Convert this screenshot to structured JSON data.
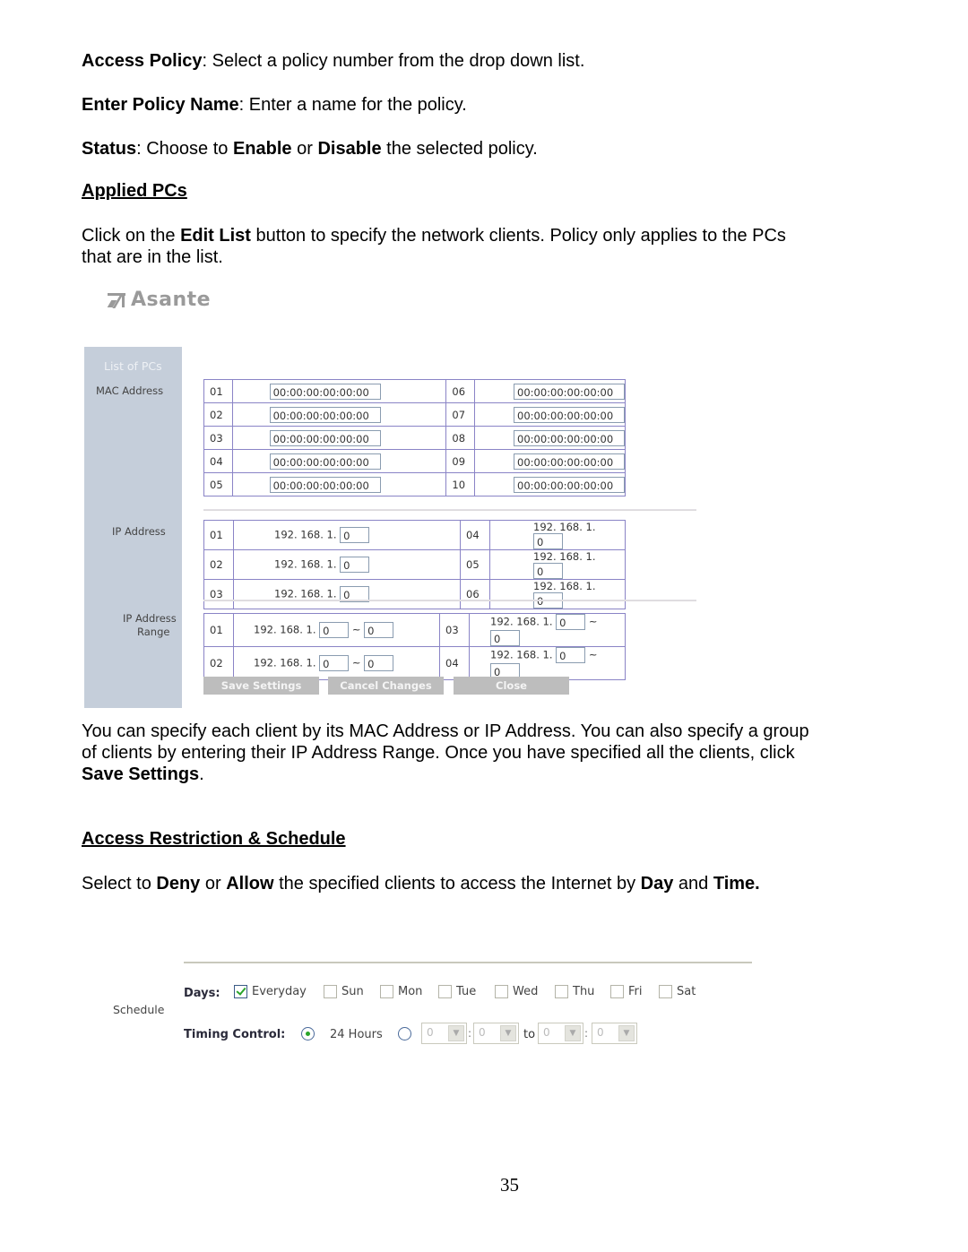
{
  "intro": {
    "access_policy": {
      "label": "Access Policy",
      "text": ": Select a policy number from the drop down list."
    },
    "policy_name": {
      "label": "Enter Policy Name",
      "text": ": Enter a name for the policy."
    },
    "status": {
      "label": "Status",
      "t1": ": Choose to ",
      "enable": "Enable",
      "t2": " or ",
      "disable": "Disable",
      "t3": " the selected policy."
    }
  },
  "applied_pcs": {
    "heading": "Applied PCs",
    "p1": "Click on the ",
    "edit_list": "Edit List",
    "p2": " button to specify the network clients. Policy only applies to the PCs that are in the list."
  },
  "pc_panel": {
    "logo_text": "Asante",
    "sidebar_title": "List of PCs",
    "mac_label": "MAC Address",
    "ip_label": "IP Address",
    "range_label_1": "IP Address",
    "range_label_2": "Range",
    "mac_rows": [
      {
        "l_num": "01",
        "l_val": "00:00:00:00:00:00",
        "r_num": "06",
        "r_val": "00:00:00:00:00:00"
      },
      {
        "l_num": "02",
        "l_val": "00:00:00:00:00:00",
        "r_num": "07",
        "r_val": "00:00:00:00:00:00"
      },
      {
        "l_num": "03",
        "l_val": "00:00:00:00:00:00",
        "r_num": "08",
        "r_val": "00:00:00:00:00:00"
      },
      {
        "l_num": "04",
        "l_val": "00:00:00:00:00:00",
        "r_num": "09",
        "r_val": "00:00:00:00:00:00"
      },
      {
        "l_num": "05",
        "l_val": "00:00:00:00:00:00",
        "r_num": "10",
        "r_val": "00:00:00:00:00:00"
      }
    ],
    "ip_prefix": "192. 168. 1.",
    "ip_rows": [
      {
        "l_num": "01",
        "l_val": "0",
        "r_num": "04",
        "r_val": "0"
      },
      {
        "l_num": "02",
        "l_val": "0",
        "r_num": "05",
        "r_val": "0"
      },
      {
        "l_num": "03",
        "l_val": "0",
        "r_num": "06",
        "r_val": "0"
      }
    ],
    "range_sep": "~",
    "range_rows": [
      {
        "l_num": "01",
        "l_from": "0",
        "l_to": "0",
        "r_num": "03",
        "r_from": "0",
        "r_to": "0"
      },
      {
        "l_num": "02",
        "l_from": "0",
        "l_to": "0",
        "r_num": "04",
        "r_from": "0",
        "r_to": "0"
      }
    ],
    "buttons": {
      "save": "Save Settings",
      "cancel": "Cancel Changes",
      "close": "Close"
    }
  },
  "after_panel": {
    "p1": "You can specify each client by its MAC Address or IP Address. You can also specify a group of clients by entering their IP Address Range. Once you have specified all the clients, click ",
    "save": "Save Settings",
    "p2": "."
  },
  "restriction": {
    "heading": "Access Restriction & Schedule",
    "t1": "Select to ",
    "deny": "Deny",
    "t2": " or ",
    "allow": "Allow",
    "t3": " the specified clients to access the Internet by ",
    "day": "Day",
    "t4": " and ",
    "time": "Time."
  },
  "schedule": {
    "label": "Schedule",
    "days_label": "Days:",
    "days": [
      {
        "label": "Everyday",
        "checked": true
      },
      {
        "label": "Sun",
        "checked": false
      },
      {
        "label": "Mon",
        "checked": false
      },
      {
        "label": "Tue",
        "checked": false
      },
      {
        "label": "Wed",
        "checked": false
      },
      {
        "label": "Thu",
        "checked": false
      },
      {
        "label": "Fri",
        "checked": false
      },
      {
        "label": "Sat",
        "checked": false
      }
    ],
    "timing_label": "Timing Control:",
    "option_24h": "24 Hours",
    "selected_option": "24 Hours",
    "from_hour": "0",
    "from_min": "0",
    "to_label": "to",
    "to_hour": "0",
    "to_min": "0",
    "colon": ":"
  },
  "page_number": "35"
}
